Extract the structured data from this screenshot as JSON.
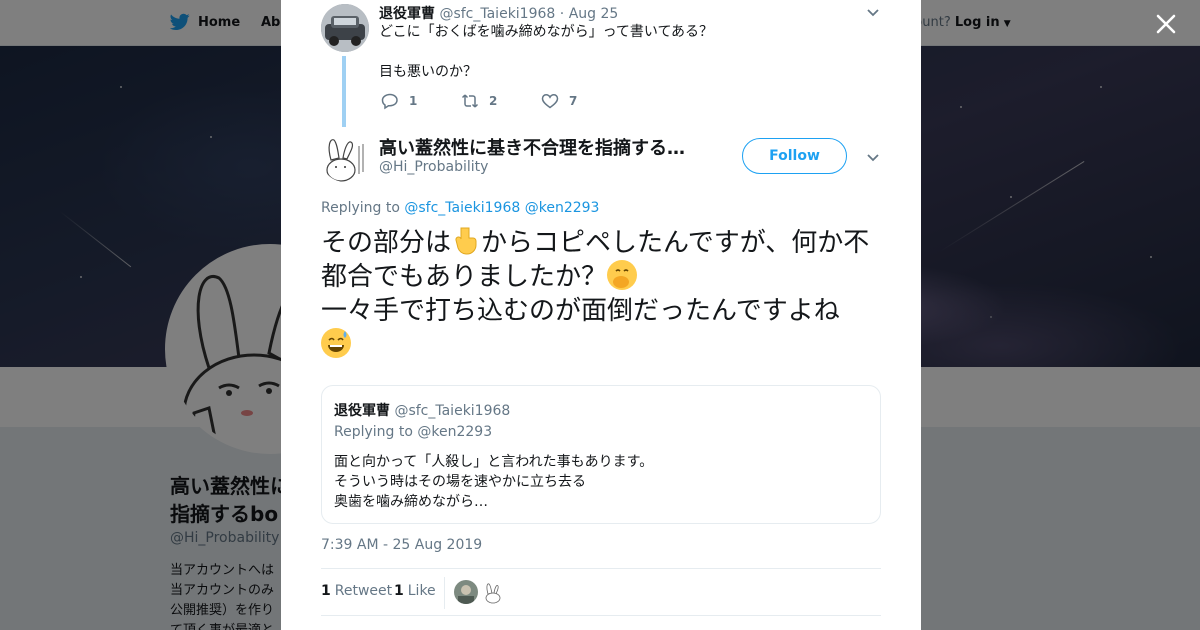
{
  "nav": {
    "home_label": "Home",
    "about_label": "Abo",
    "account_prompt": "ccount?",
    "login_label": "Log in"
  },
  "profile": {
    "name": "高い蓋然性に基き不合理を指摘するbo",
    "name_line1": "高い蓋然性に",
    "name_line2": "指摘するbo",
    "handle": "@Hi_Probability",
    "bio_lines": [
      "当アカウントへは",
      "当アカウントのみ",
      "公開推奨）を作り",
      "て頂く事が最適と"
    ]
  },
  "context_tweet": {
    "author_name": "退役軍曹",
    "author_handle": "@sfc_Taieki1968",
    "separator": "·",
    "date": "Aug 25",
    "text_lines": [
      "どこに「おくばを噛み締めながら」って書いてある？",
      "目も悪いのか？"
    ],
    "reply_count": "1",
    "retweet_count": "2",
    "like_count": "7"
  },
  "main_tweet": {
    "author_name": "高い蓋然性に基き不合理を指摘する…",
    "author_handle": "@Hi_Probability",
    "follow_label": "Follow",
    "replying_prefix": "Replying to",
    "replying_to_1": "@sfc_Taieki1968",
    "replying_to_2": "@ken2293",
    "text_part1": "その部分は",
    "text_part2": "からコピペしたんですが、何か不都合でもありましたか？",
    "text_part3": "一々手で打ち込むのが面倒だったんですよね",
    "emojis": [
      "backhand-index-pointing-down",
      "face-with-hand-over-mouth",
      "grinning-face-with-sweat"
    ],
    "timestamp": "7:39 AM - 25 Aug 2019",
    "retweets_count": "1",
    "retweets_label": "Retweet",
    "likes_count": "1",
    "likes_label": "Like"
  },
  "quoted_tweet": {
    "author_name": "退役軍曹",
    "author_handle": "@sfc_Taieki1968",
    "replying_text": "Replying to @ken2293",
    "text_lines": [
      "面と向かって「人殺し」と言われた事もあります。",
      "そういう時はその場を速やかに立ち去る",
      "奥歯を噛み締めながら…"
    ]
  },
  "colors": {
    "twitter_blue": "#1da1f2",
    "link_blue": "#1b95e0",
    "thread_line": "#9fd0f3",
    "muted_text": "#657786",
    "emoji_yellow": "#ffcc4d"
  }
}
